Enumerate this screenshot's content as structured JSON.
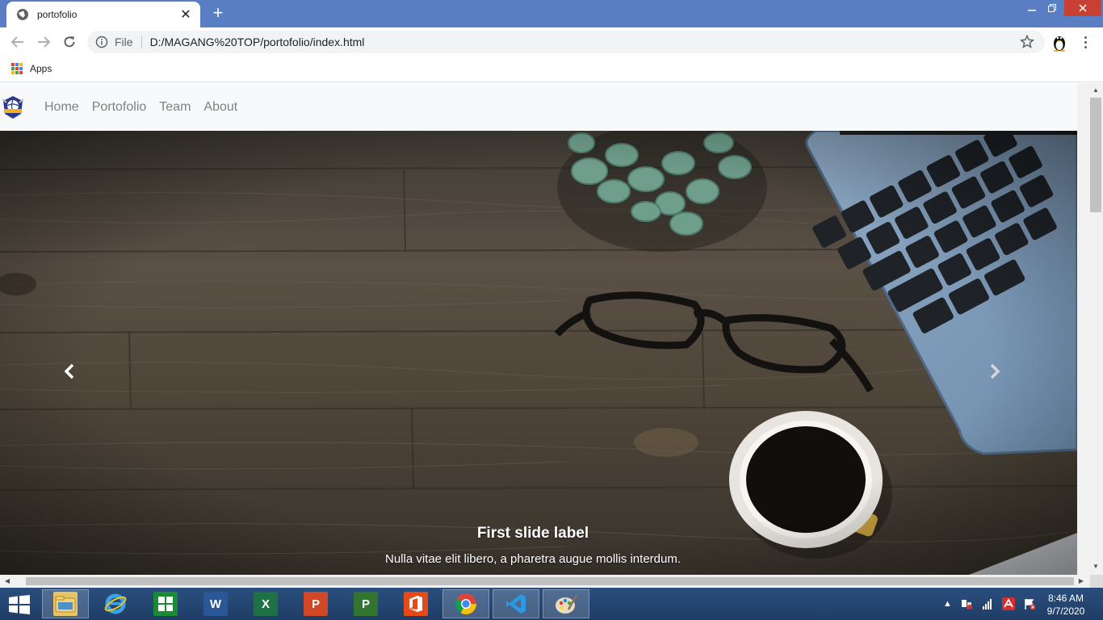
{
  "browser": {
    "tab_title": "portofolio",
    "scheme_label": "File",
    "url": "D:/MAGANG%20TOP/portofolio/index.html",
    "bookmarks": {
      "apps_label": "Apps"
    }
  },
  "navbar": {
    "links": [
      "Home",
      "Portofolio",
      "Team",
      "About"
    ]
  },
  "carousel": {
    "caption_title": "First slide label",
    "caption_text": "Nulla vitae elit libero, a pharetra augue mollis interdum."
  },
  "taskbar": {
    "apps": [
      "file-explorer",
      "internet-explorer",
      "store",
      "word",
      "excel",
      "powerpoint",
      "project",
      "office",
      "chrome",
      "vscode",
      "paint"
    ],
    "clock_time": "8:46 AM",
    "clock_date": "9/7/2020"
  },
  "colors": {
    "tabstrip": "#5a7ec3",
    "nav_link": "#808080",
    "taskbar": "#1f3d66"
  }
}
